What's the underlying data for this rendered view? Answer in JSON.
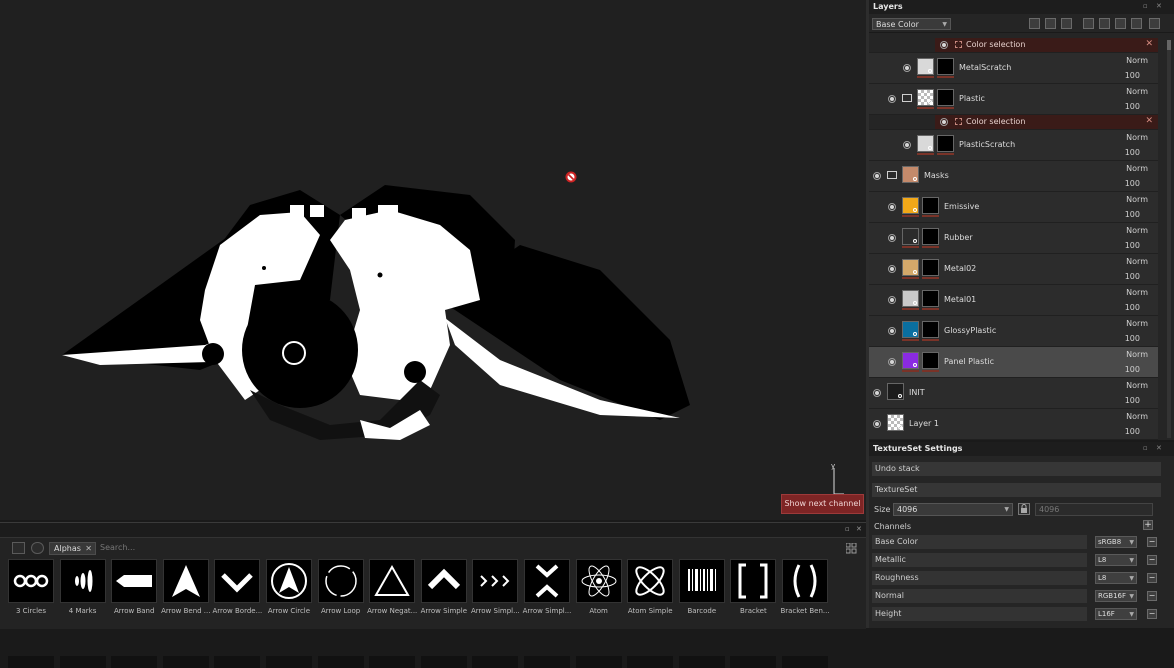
{
  "viewport": {
    "show_next_channel": "Show next channel"
  },
  "shelf": {
    "filter_tag": "Alphas",
    "search_placeholder": "Search...",
    "items": [
      {
        "label": "3 Circles",
        "icon": "three-circles-icon"
      },
      {
        "label": "4 Marks",
        "icon": "four-marks-icon"
      },
      {
        "label": "Arrow Band",
        "icon": "arrow-band-icon"
      },
      {
        "label": "Arrow Bend ...",
        "icon": "arrow-bend-icon"
      },
      {
        "label": "Arrow Borde...",
        "icon": "arrow-border-icon"
      },
      {
        "label": "Arrow Circle",
        "icon": "arrow-circle-icon"
      },
      {
        "label": "Arrow Loop",
        "icon": "arrow-loop-icon"
      },
      {
        "label": "Arrow Negat...",
        "icon": "arrow-negative-icon"
      },
      {
        "label": "Arrow Simple",
        "icon": "arrow-simple-icon"
      },
      {
        "label": "Arrow Simpl...",
        "icon": "arrow-simple-triple-icon"
      },
      {
        "label": "Arrow Simpl...",
        "icon": "arrow-simple-converge-icon"
      },
      {
        "label": "Atom",
        "icon": "atom-icon"
      },
      {
        "label": "Atom Simple",
        "icon": "atom-simple-icon"
      },
      {
        "label": "Barcode",
        "icon": "barcode-icon"
      },
      {
        "label": "Bracket",
        "icon": "bracket-icon"
      },
      {
        "label": "Bracket Ben...",
        "icon": "bracket-bent-icon"
      }
    ]
  },
  "layers_panel": {
    "title": "Layers",
    "channel": "Base Color",
    "color_selection_label": "Color selection",
    "rows": [
      {
        "type": "colsel"
      },
      {
        "type": "layer",
        "name": "MetalScratch",
        "blend": "Norm",
        "opacity": "100",
        "indent": 2,
        "swatch": "#d9d9d9",
        "mask": true
      },
      {
        "type": "folder",
        "name": "Plastic",
        "blend": "Norm",
        "opacity": "100",
        "indent": 1,
        "swatch": "checker",
        "mask": true
      },
      {
        "type": "colsel"
      },
      {
        "type": "layer",
        "name": "PlasticScratch",
        "blend": "Norm",
        "opacity": "100",
        "indent": 2,
        "swatch": "#d9d9d9",
        "mask": true
      },
      {
        "type": "folder",
        "name": "Masks",
        "blend": "Norm",
        "opacity": "100",
        "indent": 0,
        "swatch": "#c48a6b",
        "mask": false
      },
      {
        "type": "layer",
        "name": "Emissive",
        "blend": "Norm",
        "opacity": "100",
        "indent": 1,
        "swatch": "#f2a818",
        "mask": true
      },
      {
        "type": "layer",
        "name": "Rubber",
        "blend": "Norm",
        "opacity": "100",
        "indent": 1,
        "swatch": "#2b2b2b",
        "mask": true
      },
      {
        "type": "layer",
        "name": "Metal02",
        "blend": "Norm",
        "opacity": "100",
        "indent": 1,
        "swatch": "#d4a86a",
        "mask": true
      },
      {
        "type": "layer",
        "name": "Metal01",
        "blend": "Norm",
        "opacity": "100",
        "indent": 1,
        "swatch": "#c9c9c9",
        "mask": true
      },
      {
        "type": "layer",
        "name": "GlossyPlastic",
        "blend": "Norm",
        "opacity": "100",
        "indent": 1,
        "swatch": "#0a6fa0",
        "mask": true
      },
      {
        "type": "layer",
        "name": "Panel Plastic",
        "blend": "Norm",
        "opacity": "100",
        "indent": 1,
        "swatch": "#8a2be2",
        "mask": true,
        "selected": true
      },
      {
        "type": "layer",
        "name": "INIT",
        "blend": "Norm",
        "opacity": "100",
        "indent": 0,
        "swatch": "#1c1c1c",
        "mask": false
      },
      {
        "type": "layer",
        "name": "Layer 1",
        "blend": "Norm",
        "opacity": "100",
        "indent": 0,
        "swatch": "checker",
        "mask": false
      }
    ]
  },
  "textureset": {
    "title": "TextureSet Settings",
    "undo_stack": "Undo stack",
    "textureset_label": "TextureSet",
    "size_label": "Size",
    "size_value": "4096",
    "size_linked": "4096",
    "channels_label": "Channels",
    "channels": [
      {
        "name": "Base Color",
        "format": "sRGB8"
      },
      {
        "name": "Metallic",
        "format": "L8"
      },
      {
        "name": "Roughness",
        "format": "L8"
      },
      {
        "name": "Normal",
        "format": "RGB16F"
      },
      {
        "name": "Height",
        "format": "L16F"
      }
    ]
  }
}
